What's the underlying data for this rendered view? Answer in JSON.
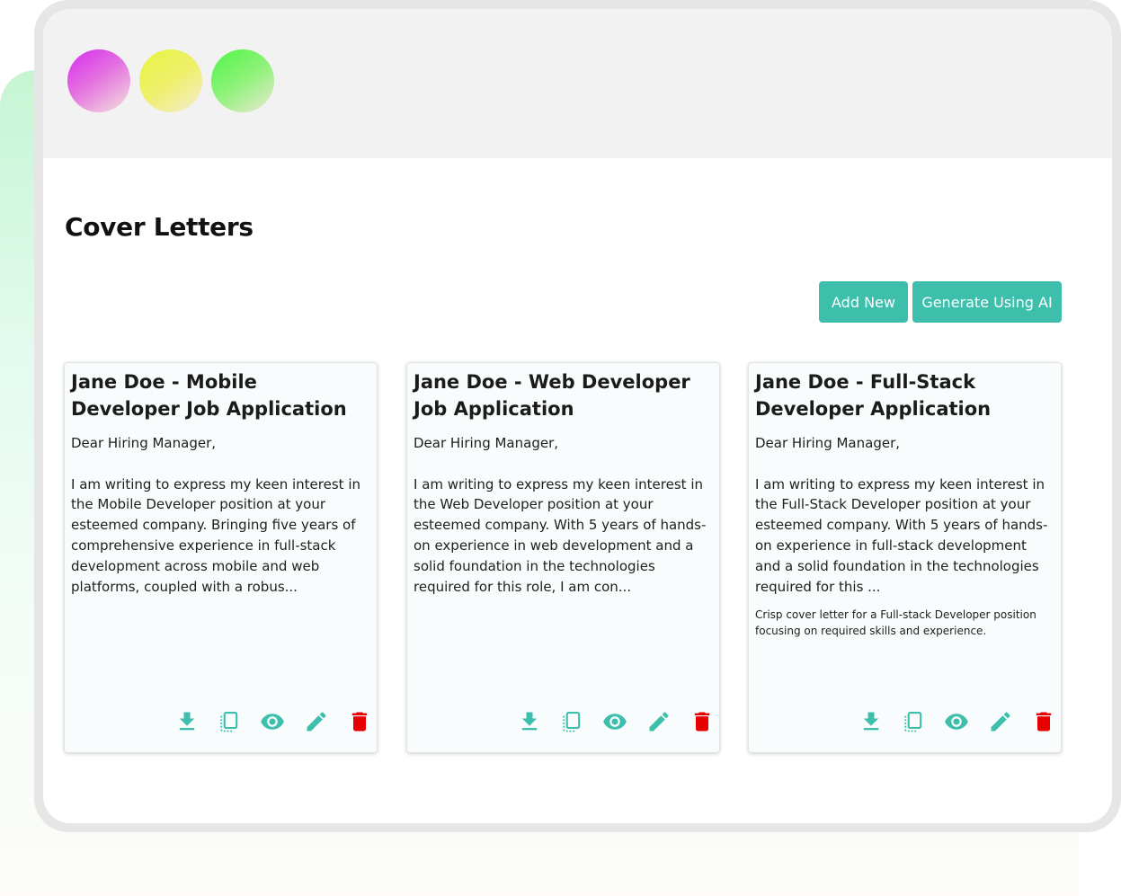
{
  "page_title": "Cover Letters",
  "toolbar": {
    "add_new_label": "Add New",
    "generate_label": "Generate Using AI"
  },
  "colors": {
    "accent": "#3dbfab",
    "delete": "#e60000",
    "titlebar": "#f2f2f2"
  },
  "window_controls": [
    "magenta-dot",
    "yellow-dot",
    "green-dot"
  ],
  "cards": [
    {
      "title": "Jane Doe - Mobile Developer Job Application",
      "greeting": "Dear Hiring Manager,",
      "excerpt": "I am writing to express my keen interest in the Mobile Developer position at your esteemed company. Bringing five years of comprehensive experience in full-stack development across mobile and web platforms, coupled with a robus...",
      "note": ""
    },
    {
      "title": "Jane Doe - Web Developer Job Application",
      "greeting": "Dear Hiring Manager,",
      "excerpt": "I am writing to express my keen interest in the Web Developer position at your esteemed company. With 5 years of hands-on experience in web development and a solid foundation in the technologies required for this role, I am con...",
      "note": ""
    },
    {
      "title": "Jane Doe - Full-Stack Developer Application",
      "greeting": "Dear Hiring Manager,",
      "excerpt": "I am writing to express my keen interest in the Full-Stack Developer position at your esteemed company. With 5 years of hands-on experience in full-stack development and a solid foundation in the technologies required for this ...",
      "note": "Crisp cover letter for a Full-stack Developer position focusing on required skills and experience."
    }
  ],
  "card_actions": [
    "download-icon",
    "copy-icon",
    "view-icon",
    "edit-icon",
    "delete-icon"
  ]
}
